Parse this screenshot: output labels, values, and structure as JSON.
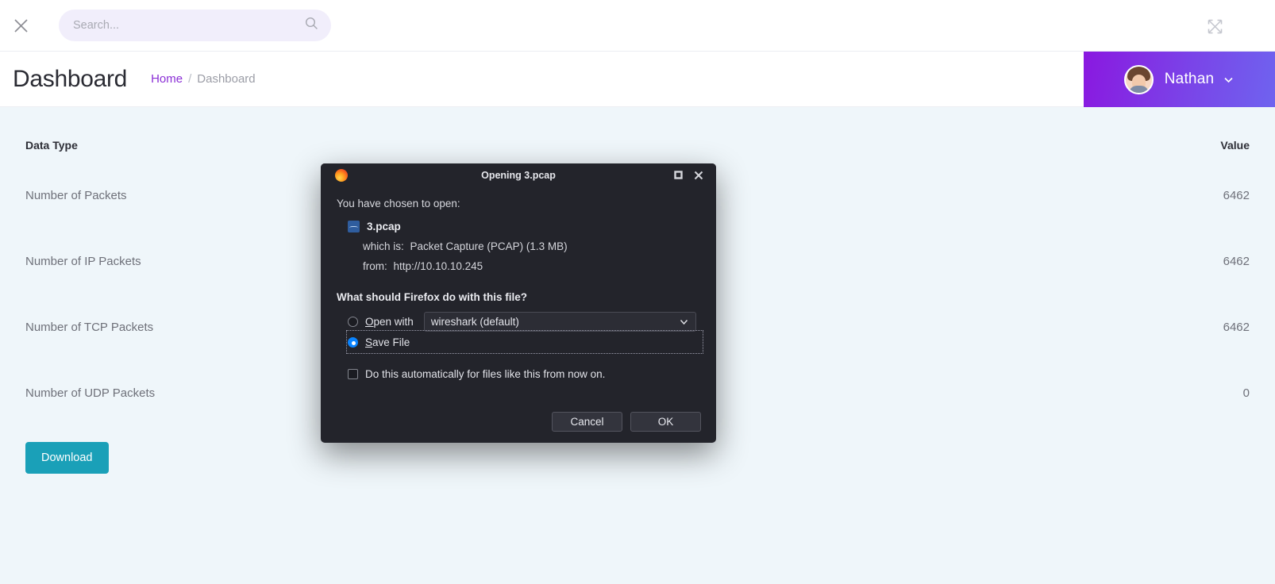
{
  "topbar": {
    "close_icon": "close-icon",
    "search": {
      "value": "",
      "placeholder": "Search..."
    },
    "search_icon": "search-icon",
    "expand_icon": "expand-icon"
  },
  "header": {
    "title": "Dashboard",
    "breadcrumb": {
      "home": "Home",
      "separator": "/",
      "current": "Dashboard"
    },
    "user": {
      "name": "Nathan",
      "caret_icon": "chevron-down-icon",
      "avatar_icon": "avatar"
    },
    "gradient_from": "#8a18e0",
    "gradient_to": "#6f63ef"
  },
  "main": {
    "table": {
      "columns": [
        "Data Type",
        "Value"
      ],
      "rows": [
        {
          "data_type": "Number of Packets",
          "value": "6462"
        },
        {
          "data_type": "Number of IP Packets",
          "value": "6462"
        },
        {
          "data_type": "Number of TCP Packets",
          "value": "6462"
        },
        {
          "data_type": "Number of UDP Packets",
          "value": "0"
        }
      ]
    },
    "download_label": "Download",
    "download_color": "#1aa0b8",
    "background": "#eff6fa"
  },
  "dialog": {
    "titlebar": {
      "app_icon": "firefox-logo-icon",
      "title": "Opening 3.pcap",
      "maximize_icon": "maximize-icon",
      "close_icon": "close-icon"
    },
    "intro": "You have chosen to open:",
    "file": {
      "icon": "pcap-file-icon",
      "name": "3.pcap",
      "which_is_label": "which is:",
      "which_is_value": "Packet Capture (PCAP) (1.3 MB)",
      "from_label": "from:",
      "from_value": "http://10.10.10.245"
    },
    "question": "What should Firefox do with this file?",
    "open_with": {
      "label": "Open with",
      "selected": "wireshark (default)",
      "caret_icon": "chevron-down-icon",
      "checked": false
    },
    "save_file": {
      "label": "Save File",
      "checked": true
    },
    "auto_checkbox": {
      "label": "Do this automatically for files like this from now on.",
      "checked": false
    },
    "buttons": {
      "cancel": "Cancel",
      "ok": "OK"
    }
  }
}
